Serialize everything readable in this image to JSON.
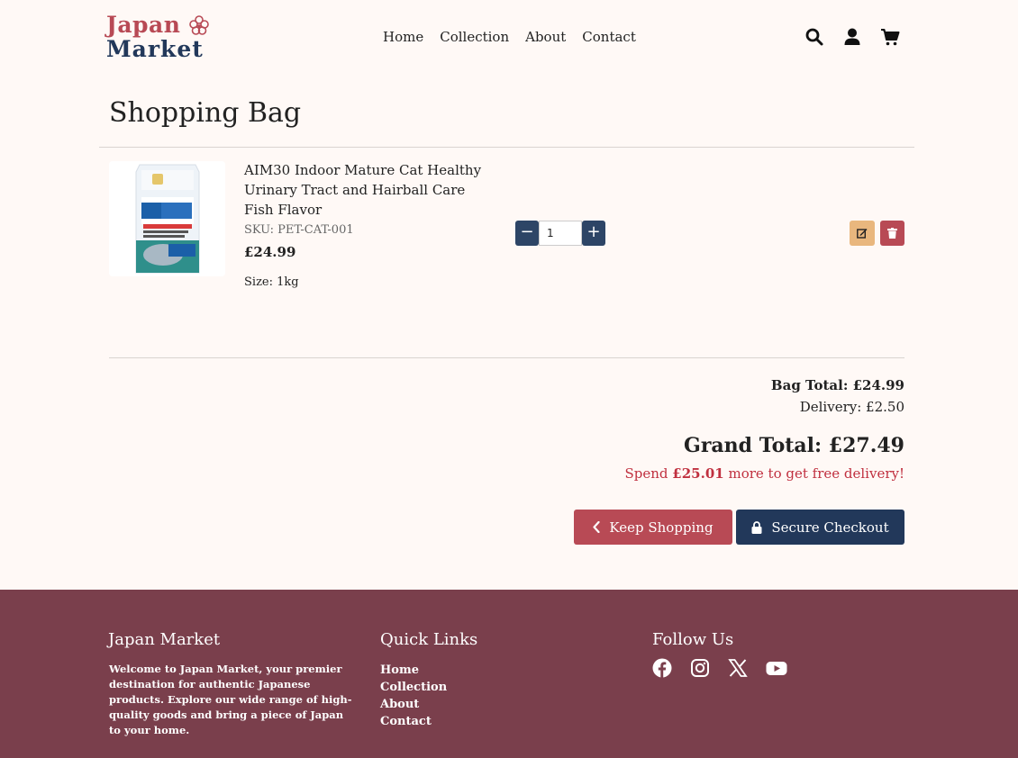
{
  "header": {
    "logo_line1": "Japan",
    "logo_line2": "Market",
    "nav": [
      "Home",
      "Collection",
      "About",
      "Contact"
    ],
    "icons": [
      "search-icon",
      "user-icon",
      "cart-icon"
    ]
  },
  "page_title": "Shopping Bag",
  "item": {
    "name": "AIM30 Indoor Mature Cat Healthy Urinary Tract and Hairball Care Fish Flavor",
    "sku": "SKU: PET-CAT-001",
    "price": "£24.99",
    "size": "Size: 1kg",
    "quantity": "1",
    "minus": "−",
    "plus": "+"
  },
  "totals": {
    "bag_total": "Bag Total: £24.99",
    "delivery": "Delivery: £2.50",
    "grand_total": "Grand Total: £27.49",
    "spend_prefix": "Spend",
    "spend_amount": "£25.01",
    "spend_suffix": "more to get free delivery!"
  },
  "actions": {
    "keep_shopping": "Keep Shopping",
    "secure_checkout": "Secure Checkout"
  },
  "footer": {
    "brand_title": "Japan Market",
    "about": "Welcome to Japan Market, your premier destination for authentic Japanese products. Explore our wide range of high-quality goods and bring a piece of Japan to your home.",
    "links_title": "Quick Links",
    "links": [
      "Home",
      "Collection",
      "About",
      "Contact"
    ],
    "follow_title": "Follow Us",
    "social": [
      "facebook-icon",
      "instagram-icon",
      "x-icon",
      "youtube-icon"
    ]
  },
  "colors": {
    "background": "#fff9f6",
    "brand_red": "#b84a55",
    "brand_navy": "#22385a",
    "edit_orange": "#e9b77e",
    "footer": "#7a3f4c",
    "alert_red": "#c0303f"
  }
}
